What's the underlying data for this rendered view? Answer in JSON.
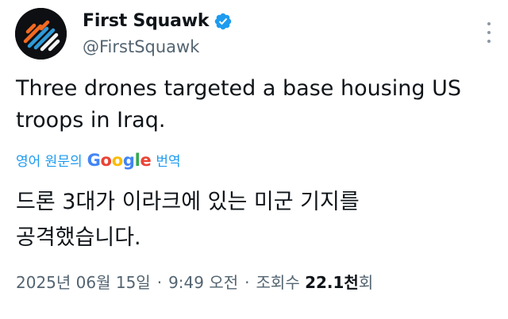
{
  "author": {
    "display_name": "First Squawk",
    "handle": "@FirstSquawk",
    "verified_badge_color": "#1d9bf0"
  },
  "tweet": {
    "text_line_1": "Three drones targeted a base housing US",
    "text_line_2": "troops in Iraq."
  },
  "translation": {
    "prefix": "영어 원문의",
    "google_letters": [
      "G",
      "o",
      "o",
      "g",
      "l",
      "e"
    ],
    "suffix": "번역",
    "link_color": "#1d9bf0",
    "text_line_1": "드론 3대가 이라크에 있는 미군 기지를",
    "text_line_2": "공격했습니다."
  },
  "meta": {
    "date": "2025년 06월 15일",
    "separator": "·",
    "time": "9:49 오전",
    "views_label": "조회수",
    "views_count": "22.1천",
    "views_suffix": "회"
  },
  "icons": {
    "avatar": "first-squawk-logo",
    "verified": "verified-badge-icon",
    "more": "more-options-icon"
  }
}
